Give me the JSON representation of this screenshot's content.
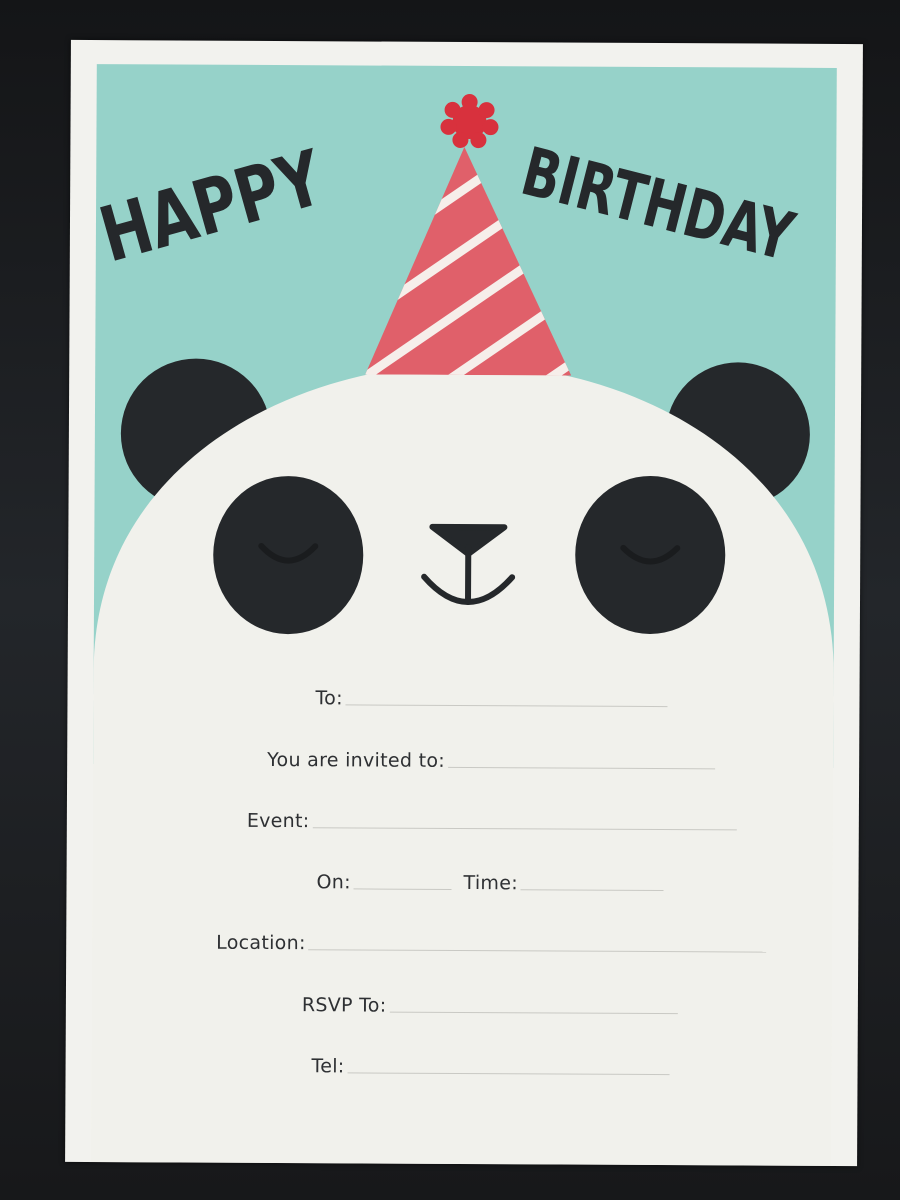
{
  "card": {
    "title_word_1": "HAPPY",
    "title_word_2": "BIRTHDAY",
    "colors": {
      "background_top": "#96d2c9",
      "panda_face": "#f1f1ec",
      "panda_black": "#25282b",
      "hat_red": "#e0606a",
      "hat_stripe": "#f6eeea",
      "pompom": "#d8313d"
    }
  },
  "form": {
    "to_label": "To:",
    "invited_label": "You are invited to:",
    "event_label": "Event:",
    "on_label": "On:",
    "time_label": "Time:",
    "location_label": "Location:",
    "rsvp_label": "RSVP To:",
    "tel_label": "Tel:"
  }
}
